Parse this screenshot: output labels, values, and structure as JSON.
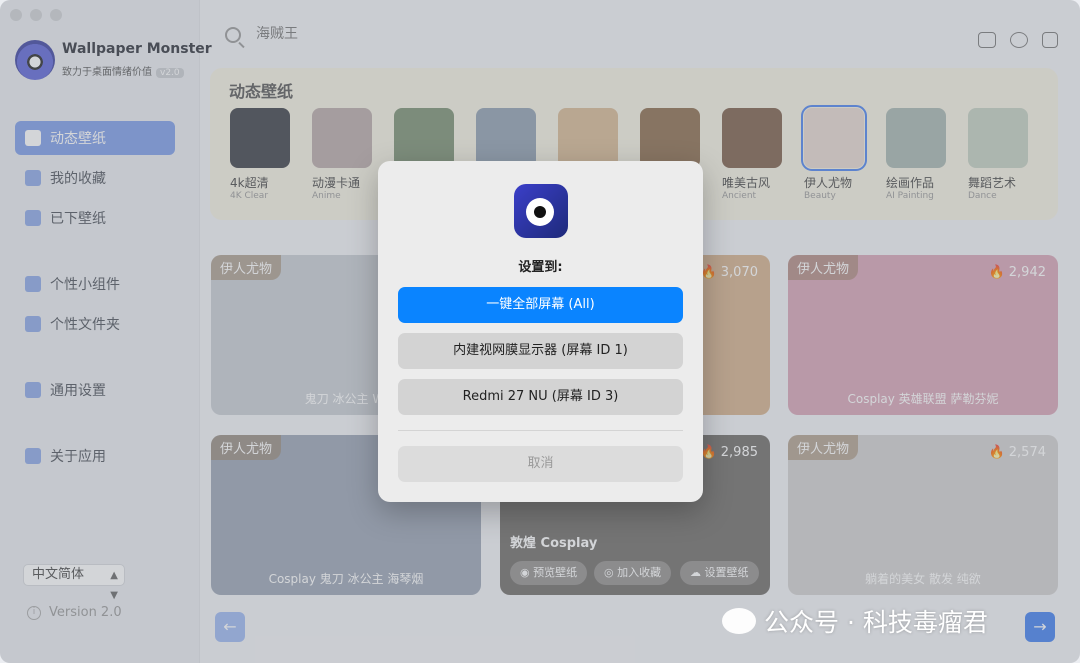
{
  "app": {
    "title": "Wallpaper Monster",
    "subtitle": "致力于桌面情绪价值",
    "version_badge": "v2.0"
  },
  "sidebar": {
    "items": [
      {
        "label": "动态壁纸",
        "active": true
      },
      {
        "label": "我的收藏"
      },
      {
        "label": "已下壁纸"
      },
      {
        "label": "个性小组件"
      },
      {
        "label": "个性文件夹"
      },
      {
        "label": "通用设置"
      },
      {
        "label": "关于应用"
      }
    ],
    "language": "中文简体",
    "version": "Version 2.0"
  },
  "search": {
    "placeholder": "海贼王"
  },
  "categories": {
    "title": "动态壁纸",
    "items": [
      {
        "name": "4k超清",
        "en": "4K Clear",
        "color": "#3a3c44"
      },
      {
        "name": "动漫卡通",
        "en": "Anime",
        "color": "#b8a9a8"
      },
      {
        "name": "",
        "en": "",
        "color": "#7a9070"
      },
      {
        "name": "",
        "en": "",
        "color": "#8f9fb0"
      },
      {
        "name": "",
        "en": "",
        "color": "#d8b892"
      },
      {
        "name": "",
        "en": "",
        "color": "#8b6a4a"
      },
      {
        "name": "唯美古风",
        "en": "Ancient",
        "color": "#7b5c48"
      },
      {
        "name": "伊人尤物",
        "en": "Beauty",
        "color": "#e6d7d0",
        "selected": true
      },
      {
        "name": "绘画作品",
        "en": "AI Painting",
        "color": "#a7b6b0"
      },
      {
        "name": "舞蹈艺术",
        "en": "Dance",
        "color": "#c4cfc0"
      }
    ]
  },
  "cards": [
    {
      "tag": "伊人尤物",
      "count": "",
      "caption": "鬼刀 冰公主 Wi",
      "color": "#c8cdd3"
    },
    {
      "tag": "",
      "count": "3,070",
      "caption": "",
      "color": "#d4b08a"
    },
    {
      "tag": "伊人尤物",
      "count": "2,942",
      "caption": "Cosplay 英雄联盟 萨勒芬妮",
      "color": "#d8a3b5"
    },
    {
      "tag": "伊人尤物",
      "count": "",
      "caption": "Cosplay 鬼刀 冰公主 海琴烟",
      "color": "#9aa4b4"
    },
    {
      "tag": "",
      "count": "2,985",
      "caption": "敦煌 Cosplay",
      "color": "#6e6a66"
    },
    {
      "tag": "伊人尤物",
      "count": "2,574",
      "caption": "躺着的美女 散发 纯欲",
      "color": "#d2d0cf"
    }
  ],
  "card_actions": {
    "preview": "预览壁纸",
    "favorite": "加入收藏",
    "set": "设置壁纸"
  },
  "dialog": {
    "title": "设置到:",
    "options": [
      "一键全部屏幕 (All)",
      "内建视网膜显示器 (屏幕 ID 1)",
      "Redmi 27 NU (屏幕 ID 3)"
    ],
    "cancel": "取消"
  },
  "watermark": "公众号 · 科技毒瘤君"
}
